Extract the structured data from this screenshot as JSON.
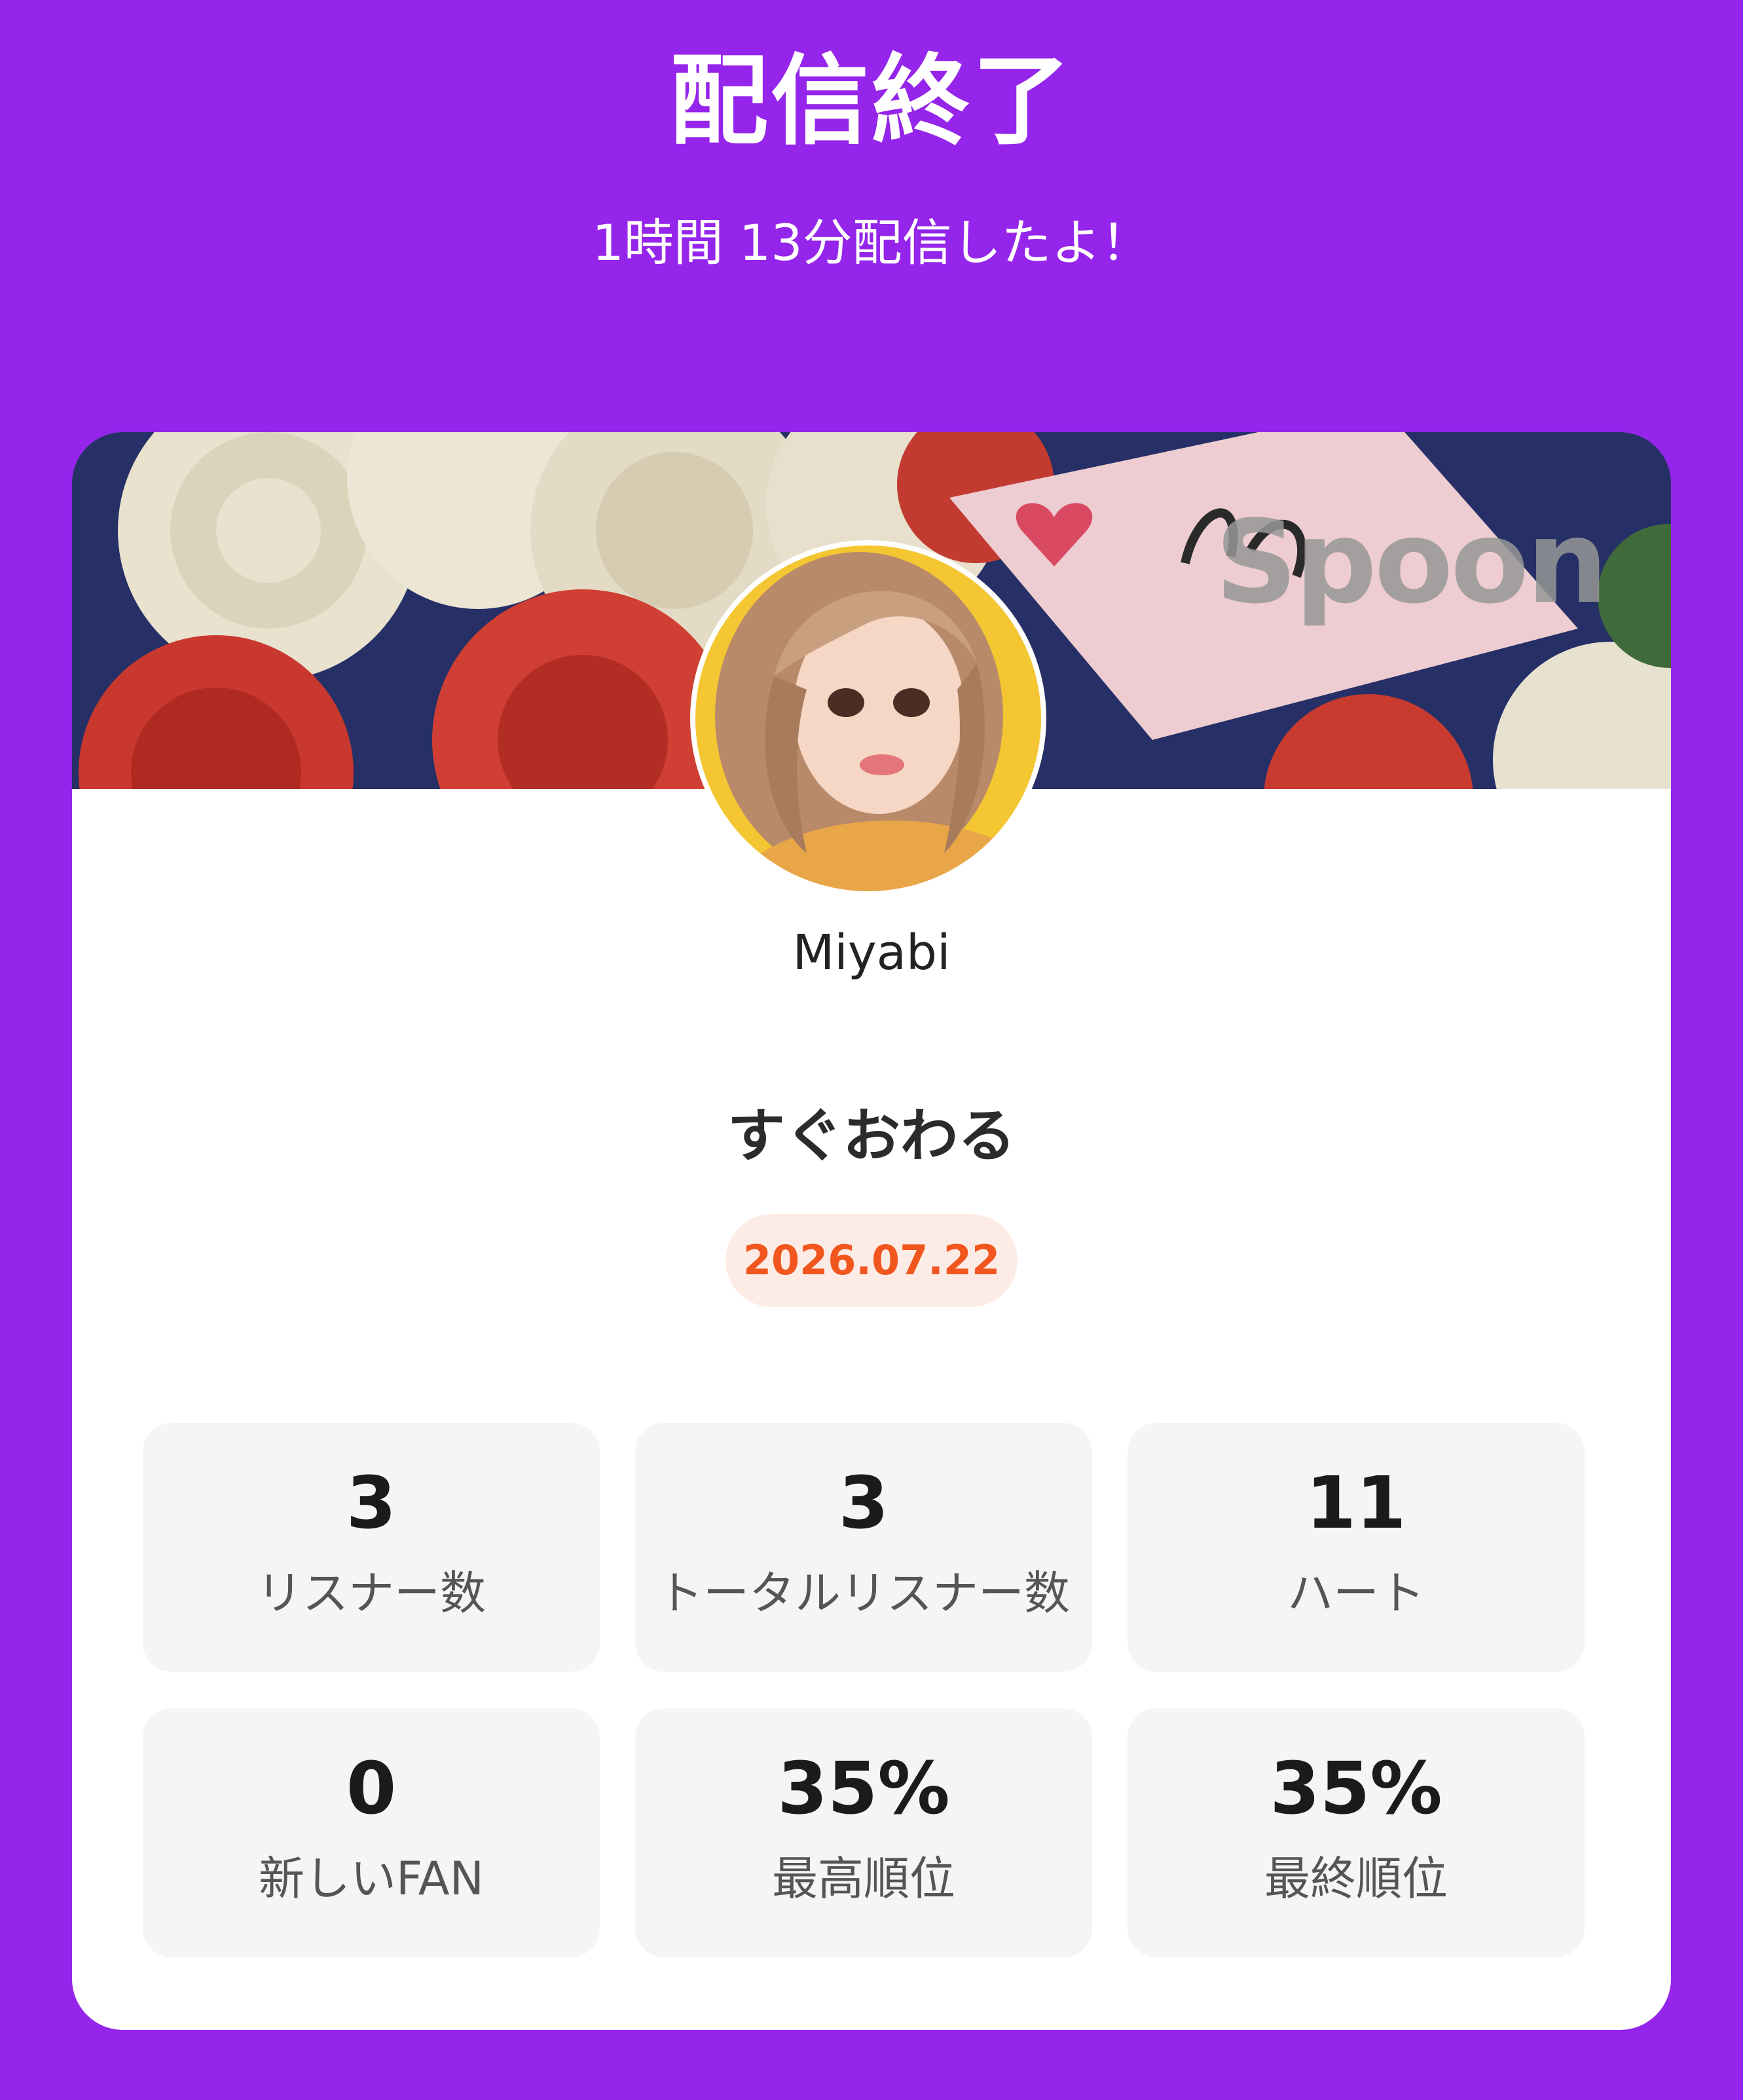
{
  "header": {
    "title": "配信終了",
    "subtitle": "1時間 13分配信したよ！"
  },
  "card": {
    "brand": "Spoon",
    "username": "Miyabi",
    "live_title": "すぐおわる",
    "date": "2026.07.22",
    "stats": [
      {
        "value": "3",
        "label": "リスナー数"
      },
      {
        "value": "3",
        "label": "トータルリスナー数"
      },
      {
        "value": "11",
        "label": "ハート"
      },
      {
        "value": "0",
        "label": "新しいFAN"
      },
      {
        "value": "35%",
        "label": "最高順位"
      },
      {
        "value": "35%",
        "label": "最終順位"
      }
    ]
  },
  "colors": {
    "background": "#9525EA",
    "date_text": "#F0561E",
    "date_badge": "#FDECE6",
    "stat_tile": "#F5F5F5"
  }
}
